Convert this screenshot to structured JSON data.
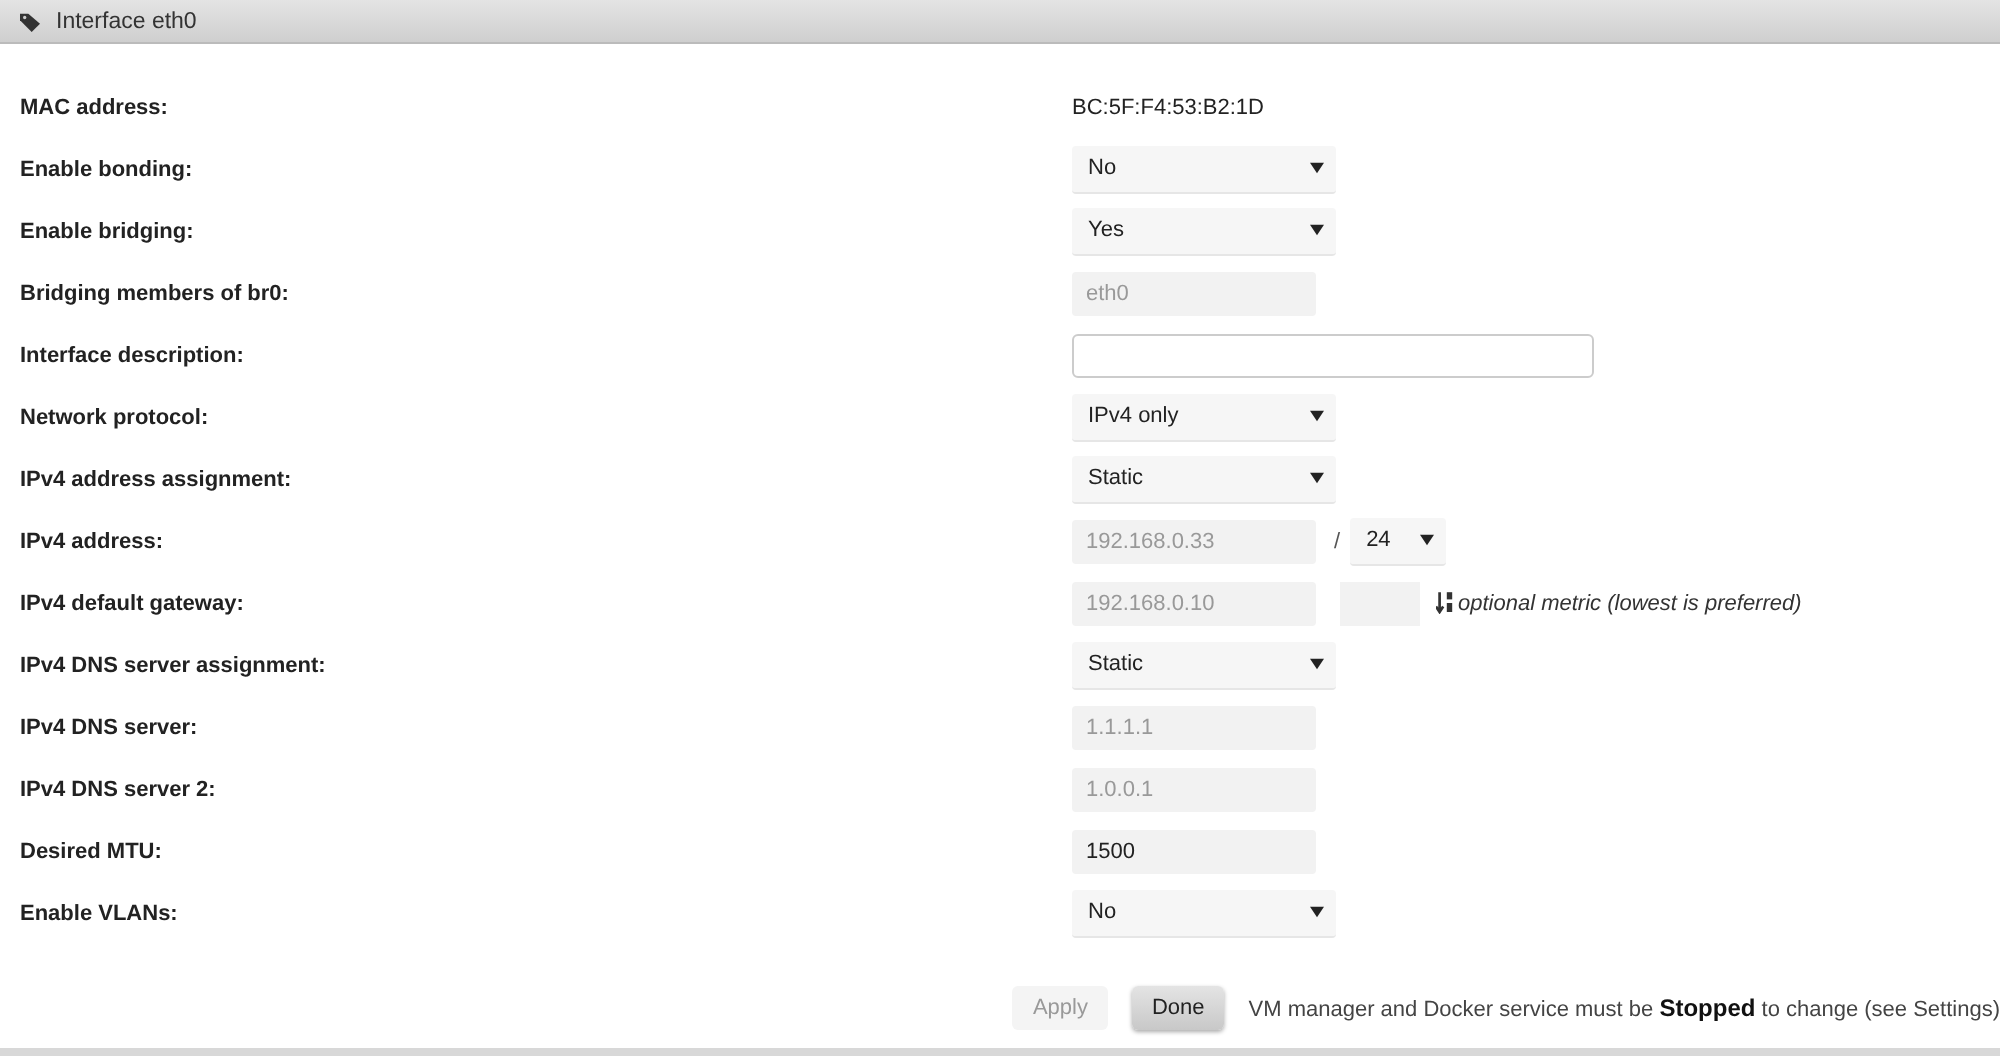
{
  "panel": {
    "title": "Interface eth0"
  },
  "rows": [
    {
      "label": "MAC address:",
      "kind": "text",
      "value": "BC:5F:F4:53:B2:1D"
    },
    {
      "label": "Enable bonding:",
      "kind": "select",
      "value": "No"
    },
    {
      "label": "Enable bridging:",
      "kind": "select",
      "value": "Yes"
    },
    {
      "label": "Bridging members of br0:",
      "kind": "input",
      "value": "eth0",
      "disabled": true
    },
    {
      "label": "Interface description:",
      "kind": "wide-input"
    },
    {
      "label": "Network protocol:",
      "kind": "select",
      "value": "IPv4 only"
    },
    {
      "label": "IPv4 address assignment:",
      "kind": "select",
      "value": "Static"
    },
    {
      "label": "IPv4 address:",
      "kind": "ip-prefix",
      "value": "192.168.0.33",
      "disabled": true,
      "separator": "/",
      "prefix": "24"
    },
    {
      "label": "IPv4 default gateway:",
      "kind": "gateway",
      "value": "192.168.0.10",
      "disabled": true,
      "metric_hint": "optional metric (lowest is preferred)"
    },
    {
      "label": "IPv4 DNS server assignment:",
      "kind": "select",
      "value": "Static"
    },
    {
      "label": "IPv4 DNS server:",
      "kind": "input",
      "value": "1.1.1.1",
      "disabled": true
    },
    {
      "label": "IPv4 DNS server 2:",
      "kind": "input",
      "value": "1.0.0.1",
      "disabled": true
    },
    {
      "label": "Desired MTU:",
      "kind": "input",
      "value": "1500",
      "disabled": false
    },
    {
      "label": "Enable VLANs:",
      "kind": "select",
      "value": "No"
    }
  ],
  "buttons": [
    {
      "label": "Apply",
      "disabled": true
    },
    {
      "label": "Done",
      "disabled": false
    }
  ],
  "note": "VM manager and Docker service must be **Stopped** to change (see Settings)"
}
